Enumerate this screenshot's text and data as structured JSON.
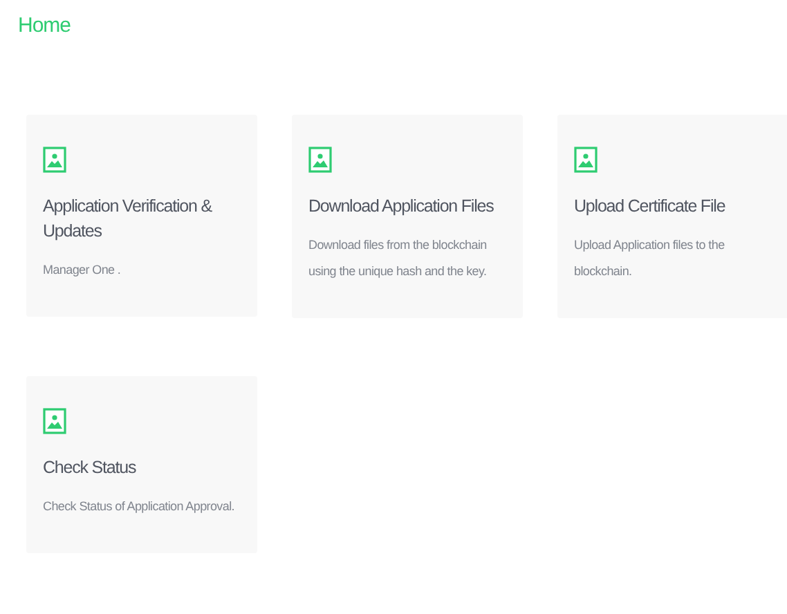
{
  "header": {
    "title": "Home"
  },
  "cards": [
    {
      "title": "Application Verification & Updates",
      "description": "Manager One ."
    },
    {
      "title": "Download Application Files",
      "description": "Download files from the blockchain using the unique hash and the key."
    },
    {
      "title": "Upload Certificate File",
      "description": "Upload Application files to the blockchain."
    },
    {
      "title": "Check Status",
      "description": "Check Status of Application Approval."
    }
  ]
}
